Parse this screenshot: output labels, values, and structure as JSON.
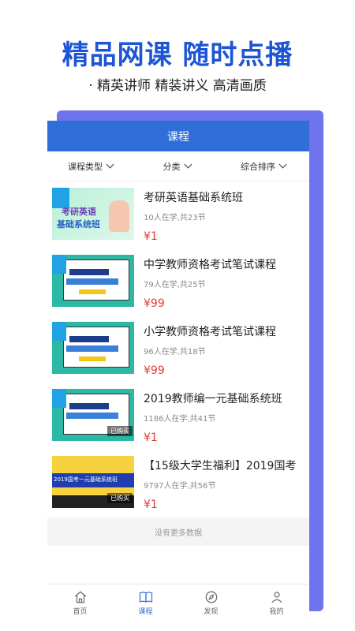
{
  "promo": {
    "headline": "精品网课 随时点播",
    "subline": "· 精英讲师 精装讲义 高清画质"
  },
  "app": {
    "header_title": "课程",
    "filters": [
      {
        "label": "课程类型"
      },
      {
        "label": "分类"
      },
      {
        "label": "综合排序"
      }
    ],
    "courses": [
      {
        "title": "考研英语基础系统班",
        "meta": "10人在学,共23节",
        "price": "¥1",
        "thumb_text": [
          "考研英语",
          "基础系统班"
        ],
        "badge": ""
      },
      {
        "title": "中学教师资格考试笔试课程",
        "meta": "79人在学,共25节",
        "price": "¥99",
        "thumb_text": [],
        "badge": ""
      },
      {
        "title": "小学教师资格考试笔试课程",
        "meta": "96人在学,共18节",
        "price": "¥99",
        "thumb_text": [],
        "badge": ""
      },
      {
        "title": "2019教师编一元基础系统班",
        "meta": "1186人在学,共41节",
        "price": "¥1",
        "thumb_text": [],
        "badge": "已购买"
      },
      {
        "title": "【15级大学生福利】2019国考",
        "meta": "9797人在学,共56节",
        "price": "¥1",
        "thumb_text": [
          "2019国考一元基础系统班"
        ],
        "badge": "已购买"
      }
    ],
    "no_more": "没有更多数据",
    "tabs": [
      {
        "label": "首页",
        "icon": "home-icon",
        "active": false
      },
      {
        "label": "课程",
        "icon": "book-icon",
        "active": true
      },
      {
        "label": "发现",
        "icon": "compass-icon",
        "active": false
      },
      {
        "label": "我的",
        "icon": "user-icon",
        "active": false
      }
    ]
  },
  "colors": {
    "brand_blue": "#2f6ed8",
    "headline_blue": "#1e55d6",
    "price_red": "#e53935",
    "side_panel": "#6f73ee"
  }
}
